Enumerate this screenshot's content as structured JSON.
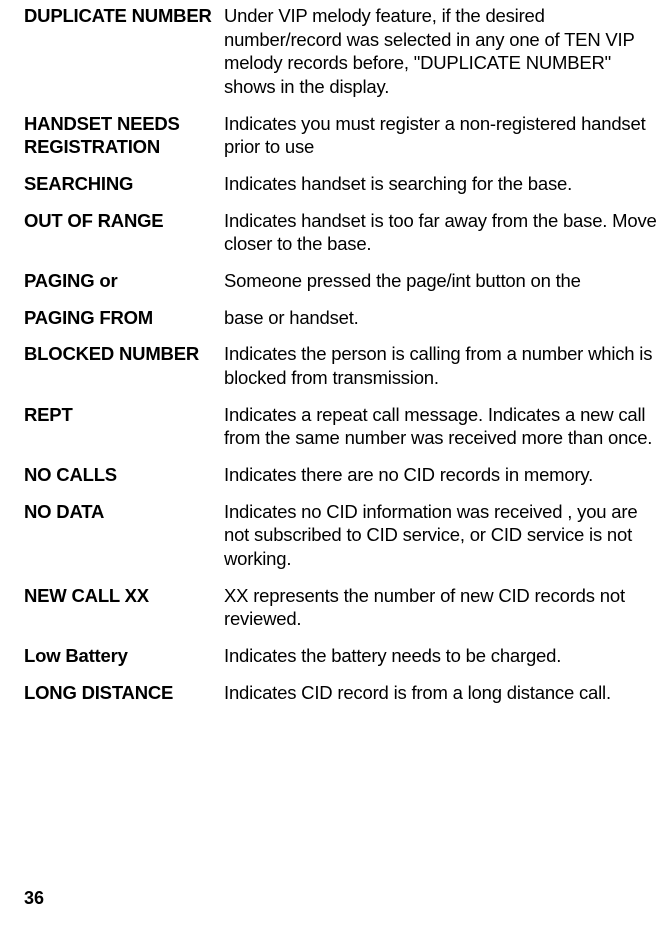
{
  "entries": [
    {
      "term": "DUPLICATE NUMBER",
      "desc": "Under VIP melody feature, if the desired number/record was selected in any one of TEN VIP melody records before, \"DUPLICATE NUMBER\" shows in the display."
    },
    {
      "term": "HANDSET NEEDS REGISTRATION",
      "desc": "Indicates you must register a non-registered handset prior to use"
    },
    {
      "term": "SEARCHING",
      "desc": "Indicates handset is searching for the base."
    },
    {
      "term": "OUT OF RANGE",
      "desc": "Indicates handset is too far away from the base. Move closer to the base."
    },
    {
      "term": "PAGING or",
      "desc": "Someone pressed the page/int button on the"
    },
    {
      "term": "PAGING FROM",
      "desc": "base or handset."
    },
    {
      "term": "BLOCKED NUMBER",
      "desc": "Indicates the person is calling from a number which is blocked from transmission."
    },
    {
      "term": "REPT",
      "desc": "Indicates a repeat call message. Indicates a new call  from the same number was received more than once."
    },
    {
      "term": "NO CALLS",
      "desc": "Indicates there are no CID records in memory."
    },
    {
      "term": "NO DATA",
      "desc": "Indicates no CID information was received , you are not subscribed to CID service, or CID service is not working."
    },
    {
      "term": "NEW CALL XX",
      "desc": "XX represents the number of new CID records not reviewed."
    },
    {
      "term": "Low Battery",
      "desc": "Indicates the battery needs to be charged."
    },
    {
      "term": "LONG DISTANCE",
      "desc": "Indicates CID record is from a long distance call."
    }
  ],
  "page_number": "36"
}
